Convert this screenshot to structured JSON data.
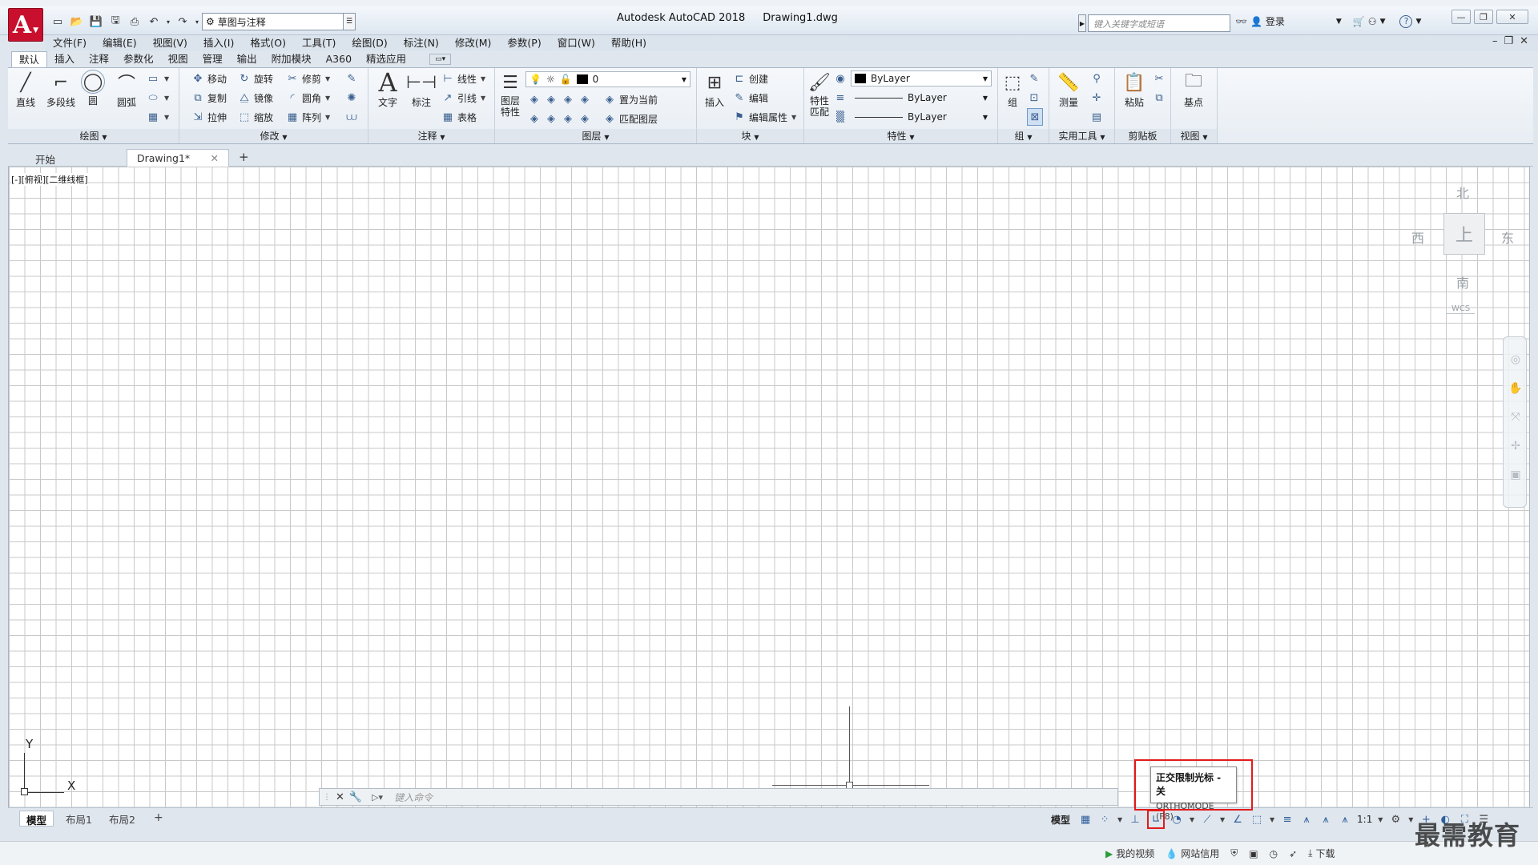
{
  "window": {
    "app_name": "Autodesk AutoCAD 2018",
    "document": "Drawing1.dwg",
    "logo_letter": "A",
    "workspace": "草图与注释",
    "search_placeholder": "键入关键字或短语",
    "login": "登录",
    "help": "?"
  },
  "menubar": [
    "文件(F)",
    "编辑(E)",
    "视图(V)",
    "插入(I)",
    "格式(O)",
    "工具(T)",
    "绘图(D)",
    "标注(N)",
    "修改(M)",
    "参数(P)",
    "窗口(W)",
    "帮助(H)"
  ],
  "ribbon_tabs": [
    "默认",
    "插入",
    "注释",
    "参数化",
    "视图",
    "管理",
    "输出",
    "附加模块",
    "A360",
    "精选应用"
  ],
  "ribbon": {
    "draw": {
      "title": "绘图",
      "line": "直线",
      "polyline": "多段线",
      "circle": "圆",
      "arc": "圆弧"
    },
    "modify": {
      "title": "修改",
      "move": "移动",
      "rotate": "旋转",
      "trim": "修剪",
      "copy": "复制",
      "mirror": "镜像",
      "fillet": "圆角",
      "stretch": "拉伸",
      "scale": "缩放",
      "array": "阵列"
    },
    "annotation": {
      "title": "注释",
      "text": "文字",
      "dimension": "标注",
      "linear": "线性",
      "leader": "引线",
      "table": "表格"
    },
    "layers": {
      "title": "图层",
      "layer_props": "图层\n特性",
      "layer_value": "0",
      "set_current": "置为当前",
      "match_layer": "匹配图层"
    },
    "block": {
      "title": "块",
      "insert": "插入",
      "create": "创建",
      "edit": "编辑",
      "edit_attr": "编辑属性"
    },
    "properties": {
      "title": "特性",
      "match": "特性\n匹配",
      "color": "ByLayer",
      "linetype": "ByLayer",
      "lineweight": "ByLayer"
    },
    "groups": {
      "title": "组",
      "group": "组"
    },
    "utilities": {
      "title": "实用工具",
      "measure": "测量"
    },
    "clipboard": {
      "title": "剪贴板",
      "paste": "粘贴"
    },
    "view": {
      "title": "视图",
      "base": "基点"
    }
  },
  "file_tabs": {
    "start": "开始",
    "drawing": "Drawing1*",
    "add": "+"
  },
  "viewport": {
    "label": "[-][俯视][二维线框]",
    "viewcube": {
      "north": "北",
      "south": "南",
      "east": "东",
      "west": "西",
      "top": "上",
      "wcs": "WCS"
    },
    "ucs": {
      "x": "X",
      "y": "Y"
    }
  },
  "command": {
    "placeholder": "键入命令"
  },
  "layout_tabs": [
    "模型",
    "布局1",
    "布局2"
  ],
  "status": {
    "model": "模型",
    "scale": "1:1"
  },
  "tooltip": {
    "title": "正交限制光标 - 关",
    "subtitle": "ORTHOMODE (F8)"
  },
  "taskbar": {
    "my_video": "我的视频",
    "site_trust": "网站信用",
    "download": "下载"
  },
  "watermark": "最需教育",
  "colors": {
    "accent_red": "#e21b1b",
    "logo": "#c8102e",
    "grid": "#c9c9c9"
  }
}
